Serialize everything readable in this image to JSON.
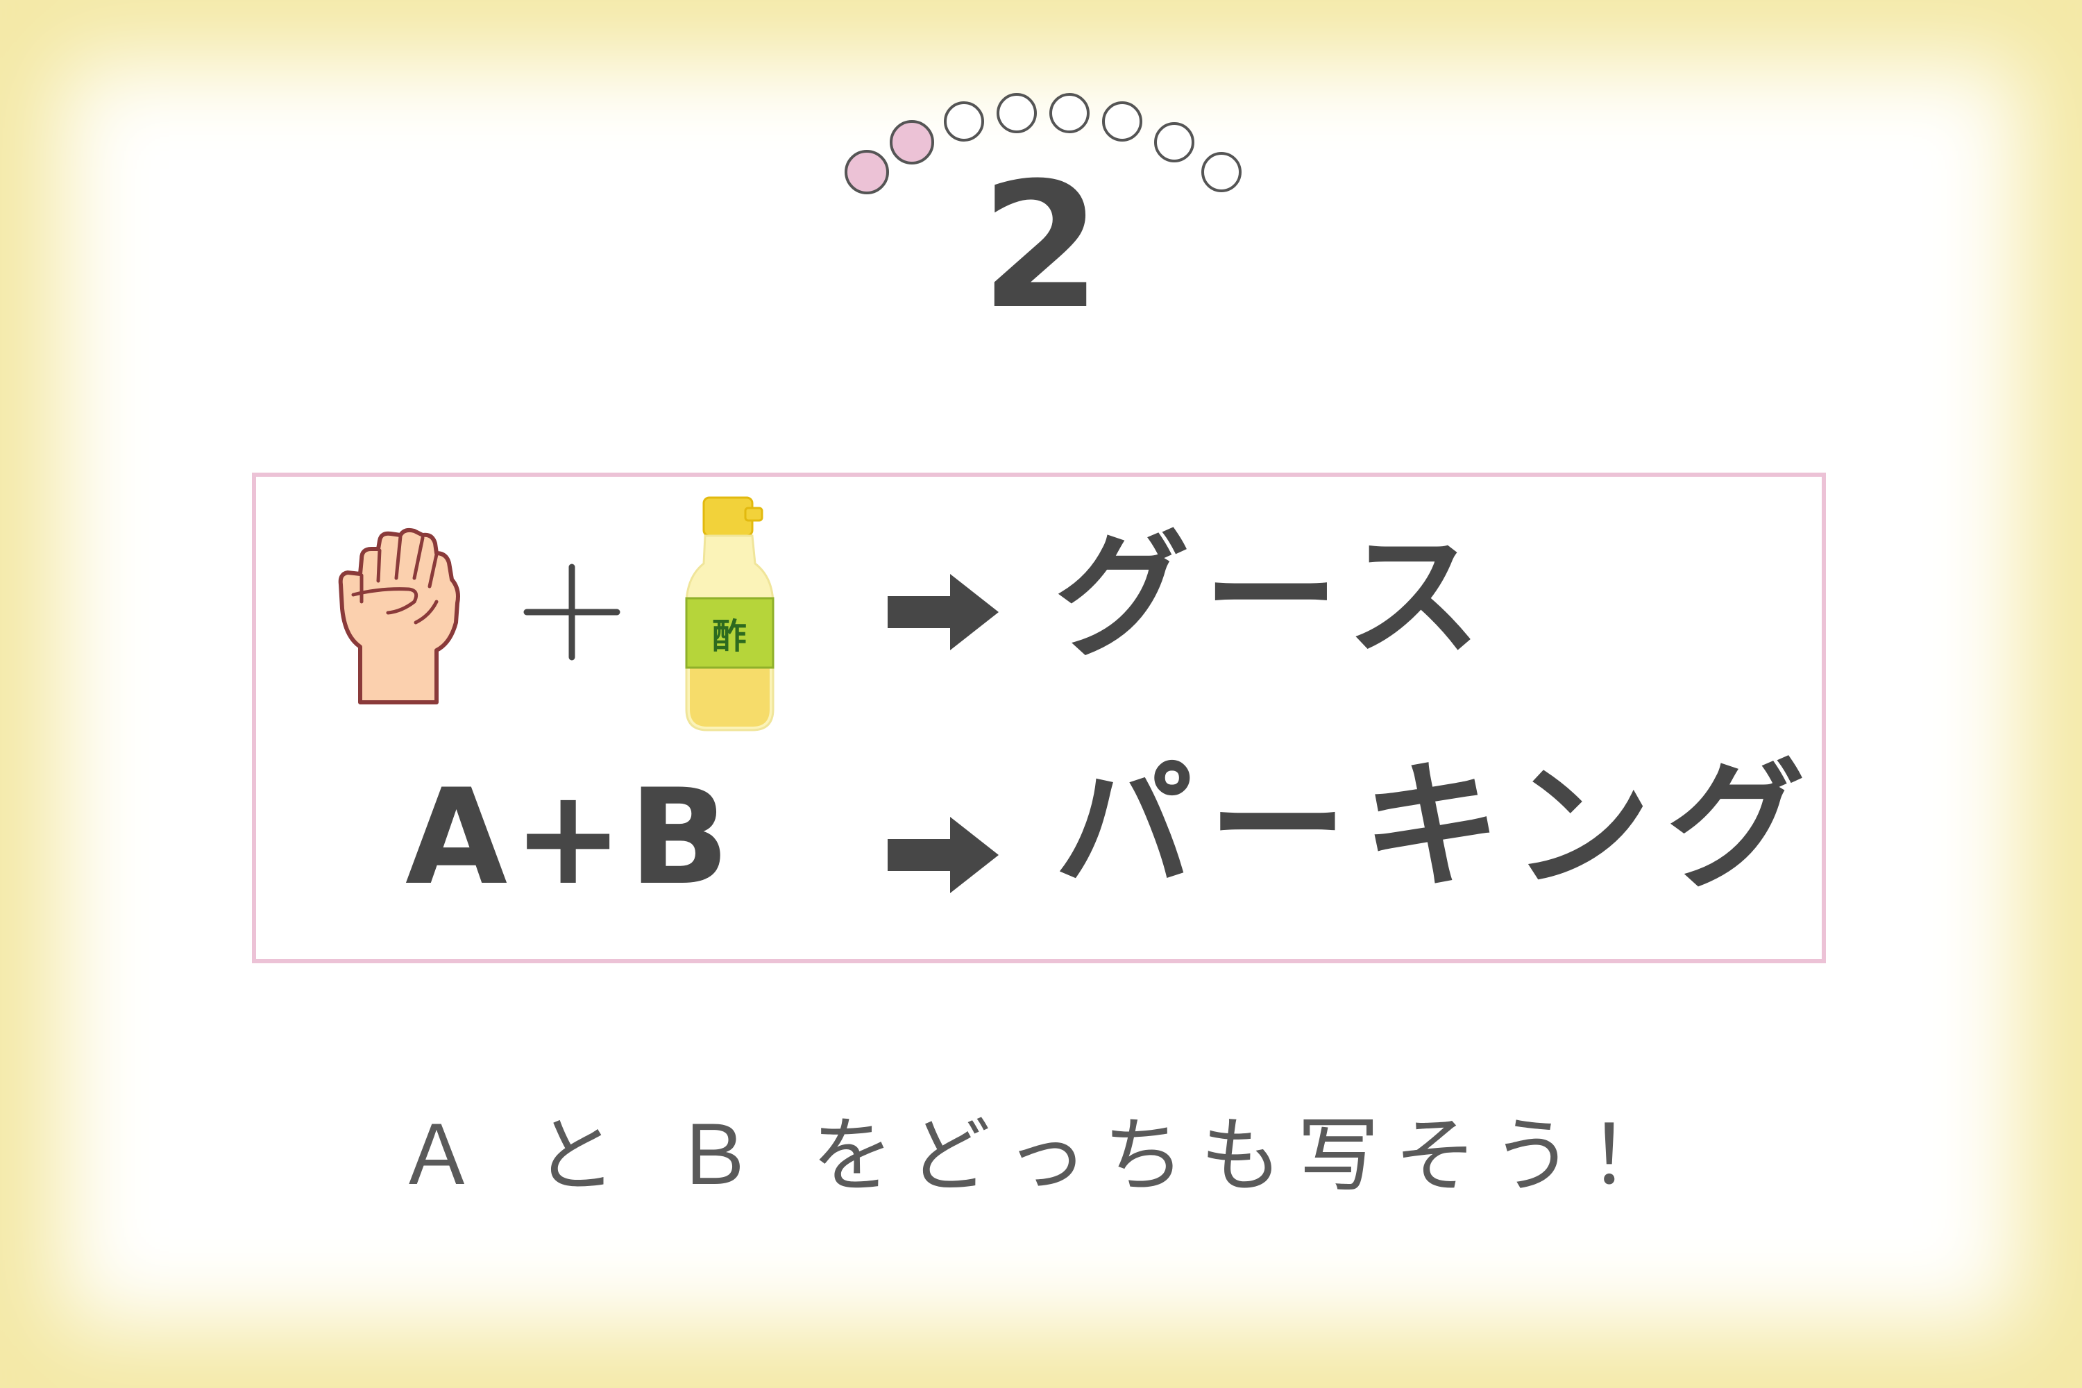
{
  "progress": {
    "total": 9,
    "completed": 2,
    "filled_color": "#ecc2d6",
    "empty_color": "#ffffff",
    "outline_color": "#555555"
  },
  "question_number": "2",
  "colors": {
    "background": "#f4e9a6",
    "box_border": "#ecc2d6",
    "text": "#474747"
  },
  "clue": {
    "icons": [
      "fist-icon",
      "vinegar-bottle-icon"
    ],
    "plus": "＋",
    "bottle_label": "酢",
    "answer": "グース"
  },
  "question": {
    "formula": "A+B",
    "answer": "パーキング"
  },
  "hint": "Ａ と Ｂ をどっちも写そう！"
}
